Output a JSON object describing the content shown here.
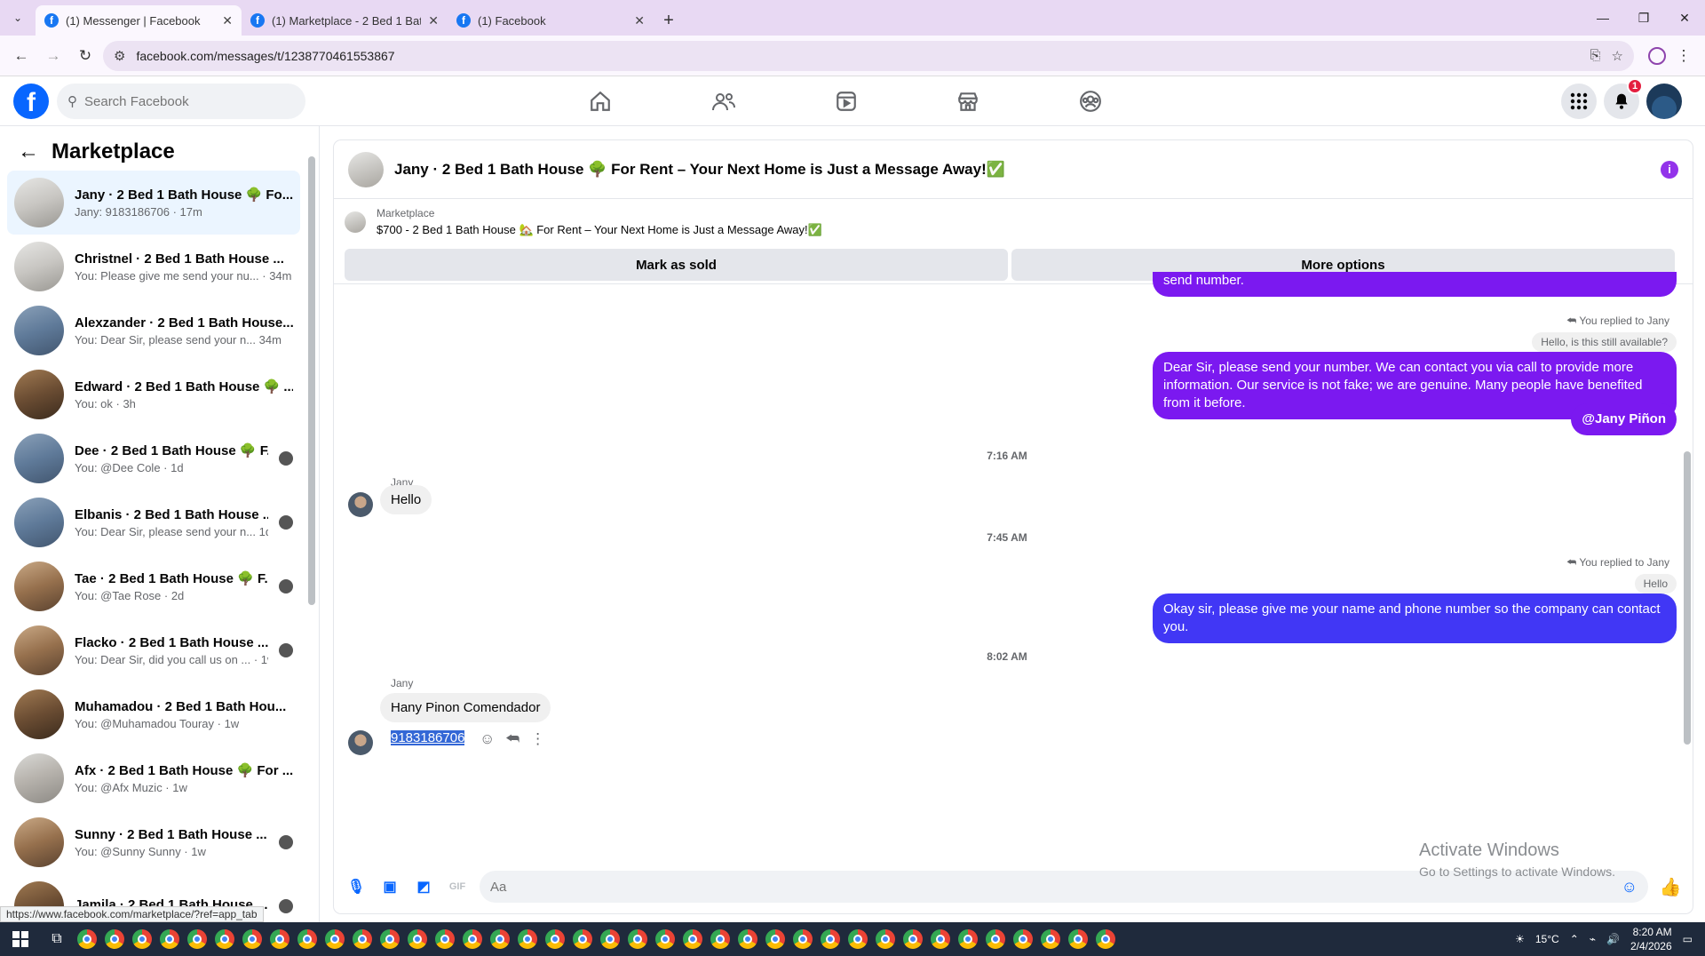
{
  "browser": {
    "tabs": [
      {
        "title": "(1) Messenger | Facebook",
        "active": true
      },
      {
        "title": "(1) Marketplace - 2 Bed 1 Bath H",
        "active": false
      },
      {
        "title": "(1) Facebook",
        "active": false
      }
    ],
    "url": "facebook.com/messages/t/1238770461553867"
  },
  "fb": {
    "search_placeholder": "Search Facebook",
    "notification_count": "1",
    "nav_icons": [
      "home-icon",
      "friends-icon",
      "video-icon",
      "marketplace-icon",
      "groups-icon"
    ]
  },
  "sidebar": {
    "title": "Marketplace",
    "conversations": [
      {
        "name": "Jany · 2 Bed 1 Bath House 🌳 Fo...",
        "sub": "Jany: 9183186706 · 17m",
        "selected": true,
        "thumb": "t2"
      },
      {
        "name": "Christnel · 2 Bed 1 Bath House ...",
        "sub": "You: Please give me send your nu... · 34m",
        "thumb": "t2"
      },
      {
        "name": "Alexzander · 2 Bed 1 Bath House...",
        "sub": "You: Dear Sir, please send your n... 34m",
        "thumb": "t3"
      },
      {
        "name": "Edward · 2 Bed 1 Bath House 🌳 ...",
        "sub": "You: ok · 3h",
        "thumb": "t4"
      },
      {
        "name": "Dee · 2 Bed 1 Bath House 🌳 F...",
        "sub": "You: @Dee Cole · 1d",
        "thumb": "t3",
        "mini": true
      },
      {
        "name": "Elbanis · 2 Bed 1 Bath House ...",
        "sub": "You: Dear Sir, please send your n... 1d",
        "thumb": "t3",
        "mini": true
      },
      {
        "name": "Tae · 2 Bed 1 Bath House 🌳 F...",
        "sub": "You: @Tae Rose · 2d",
        "thumb": "t5",
        "mini": true
      },
      {
        "name": "Flacko · 2 Bed 1 Bath House ...",
        "sub": "You: Dear Sir, did you call us on ... · 1w",
        "thumb": "t5",
        "mini": true
      },
      {
        "name": "Muhamadou · 2 Bed 1 Bath Hou...",
        "sub": "You: @Muhamadou Touray · 1w",
        "thumb": "t4"
      },
      {
        "name": "Afx · 2 Bed 1 Bath House 🌳 For ...",
        "sub": "You: @Afx Muzic · 1w",
        "thumb": "t1"
      },
      {
        "name": "Sunny · 2 Bed 1 Bath House ...",
        "sub": "You: @Sunny Sunny · 1w",
        "thumb": "t5",
        "mini": true
      },
      {
        "name": "Jamila · 2 Bed 1 Bath House ...",
        "sub": "",
        "thumb": "t4",
        "mini": true
      }
    ],
    "status_url": "https://www.facebook.com/marketplace/?ref=app_tab"
  },
  "chat": {
    "title": "Jany · 2 Bed 1 Bath House 🌳 For Rent – Your Next Home is Just a Message Away!✅",
    "listing_label": "Marketplace",
    "listing_title": "$700 - 2 Bed 1 Bath House 🏡 For Rent – Your Next Home is Just a Message Away!✅",
    "mark_sold": "Mark as sold",
    "more_options": "More options",
    "partial_msg": "send  number.",
    "reply_note_1": "You replied to Jany",
    "reply_quote_1": "Hello, is this still available?",
    "msg_out_1": "Dear Sir, please send your number. We can contact you via call to provide more information. Our service is not fake; we are genuine. Many people have benefited from it before.",
    "mention": "@Jany Piñon",
    "time_1": "7:16 AM",
    "sender_1": "Jany",
    "msg_in_1": "Hello",
    "time_2": "7:45 AM",
    "reply_note_2": "You replied to Jany",
    "reply_quote_2": "Hello",
    "msg_out_2": "Okay sir, please give me your name and phone number so the company can contact you.",
    "time_3": "8:02 AM",
    "sender_2": "Jany",
    "msg_in_2": "Hany Pinon Comendador",
    "msg_in_3": "9183186706",
    "composer_placeholder": "Aa"
  },
  "watermark": {
    "line1": "Activate Windows",
    "line2": "Go to Settings to activate Windows."
  },
  "taskbar": {
    "temperature": "15°C",
    "time": "8:20 AM",
    "date": "2/4/2026"
  },
  "colors": {
    "fb_blue": "#0866ff",
    "purple_bubble": "#7b19f0",
    "blue_bubble": "#4137f5"
  }
}
